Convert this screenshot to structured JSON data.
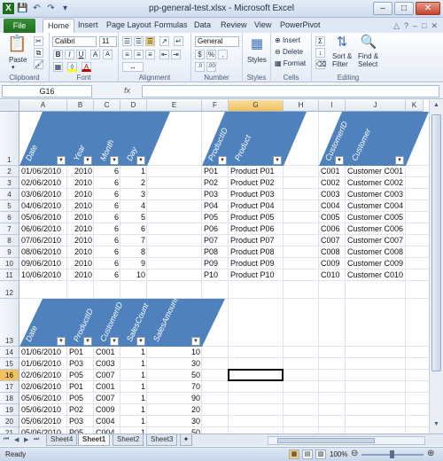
{
  "window": {
    "title": "pp-general-test.xlsx - Microsoft Excel"
  },
  "ribbon_tabs": [
    "File",
    "Home",
    "Insert",
    "Page Layout",
    "Formulas",
    "Data",
    "Review",
    "View",
    "PowerPivot"
  ],
  "ribbon": {
    "clipboard": {
      "label": "Clipboard",
      "paste": "Paste"
    },
    "font": {
      "label": "Font",
      "font_name": "Calibri",
      "font_size": "11"
    },
    "alignment": {
      "label": "Alignment"
    },
    "number": {
      "label": "Number",
      "format": "General"
    },
    "styles": {
      "label": "Styles"
    },
    "cells": {
      "label": "Cells",
      "insert": "Insert",
      "delete": "Delete",
      "format": "Format"
    },
    "editing": {
      "label": "Editing",
      "sort_filter": "Sort &\nFilter",
      "find_select": "Find &\nSelect"
    }
  },
  "formula_bar": {
    "name_box": "G16",
    "fx": "fx",
    "content": ""
  },
  "accent_colors": {
    "table_header": "#4f81bd",
    "selection": "#f1c15f"
  },
  "columns": [
    "A",
    "B",
    "C",
    "D",
    "E",
    "F",
    "G",
    "H",
    "I",
    "J",
    "K"
  ],
  "rows": [
    "1",
    "2",
    "3",
    "4",
    "5",
    "6",
    "7",
    "8",
    "9",
    "10",
    "11",
    "12",
    "13",
    "14",
    "15",
    "16",
    "17",
    "18",
    "19",
    "20",
    "21"
  ],
  "selected_cell": {
    "col": "G",
    "row": "16"
  },
  "date_table": {
    "headers": [
      "Date",
      "Year",
      "Month",
      "Day"
    ],
    "rows": [
      [
        "01/06/2010",
        "2010",
        "6",
        "1"
      ],
      [
        "02/06/2010",
        "2010",
        "6",
        "2"
      ],
      [
        "03/06/2010",
        "2010",
        "6",
        "3"
      ],
      [
        "04/06/2010",
        "2010",
        "6",
        "4"
      ],
      [
        "05/06/2010",
        "2010",
        "6",
        "5"
      ],
      [
        "06/06/2010",
        "2010",
        "6",
        "6"
      ],
      [
        "07/06/2010",
        "2010",
        "6",
        "7"
      ],
      [
        "08/06/2010",
        "2010",
        "6",
        "8"
      ],
      [
        "09/06/2010",
        "2010",
        "6",
        "9"
      ],
      [
        "10/06/2010",
        "2010",
        "6",
        "10"
      ]
    ]
  },
  "product_table": {
    "headers": [
      "ProductID",
      "Product"
    ],
    "rows": [
      [
        "P01",
        "Product P01"
      ],
      [
        "P02",
        "Product P02"
      ],
      [
        "P03",
        "Product P03"
      ],
      [
        "P04",
        "Product P04"
      ],
      [
        "P05",
        "Product P05"
      ],
      [
        "P06",
        "Product P06"
      ],
      [
        "P07",
        "Product P07"
      ],
      [
        "P08",
        "Product P08"
      ],
      [
        "P09",
        "Product P09"
      ],
      [
        "P10",
        "Product P10"
      ]
    ]
  },
  "customer_table": {
    "headers": [
      "CustomerID",
      "Customer"
    ],
    "rows": [
      [
        "C001",
        "Customer C001"
      ],
      [
        "C002",
        "Customer C002"
      ],
      [
        "C003",
        "Customer C003"
      ],
      [
        "C004",
        "Customer C004"
      ],
      [
        "C005",
        "Customer C005"
      ],
      [
        "C006",
        "Customer C006"
      ],
      [
        "C007",
        "Customer C007"
      ],
      [
        "C008",
        "Customer C008"
      ],
      [
        "C009",
        "Customer C009"
      ],
      [
        "C010",
        "Customer C010"
      ]
    ]
  },
  "sales_table": {
    "headers": [
      "Date",
      "ProductID",
      "CustomerID",
      "SalesCount",
      "SalesAmount"
    ],
    "rows": [
      [
        "01/06/2010",
        "P01",
        "C001",
        "1",
        "10"
      ],
      [
        "01/06/2010",
        "P03",
        "C003",
        "1",
        "30"
      ],
      [
        "02/06/2010",
        "P05",
        "C007",
        "1",
        "50"
      ],
      [
        "02/06/2010",
        "P01",
        "C001",
        "1",
        "70"
      ],
      [
        "05/06/2010",
        "P05",
        "C007",
        "1",
        "90"
      ],
      [
        "05/06/2010",
        "P02",
        "C009",
        "1",
        "20"
      ],
      [
        "05/06/2010",
        "P03",
        "C004",
        "1",
        "30"
      ],
      [
        "05/06/2010",
        "P05",
        "C004",
        "1",
        "50"
      ]
    ]
  },
  "sheet_tabs": [
    "Sheet4",
    "Sheet1",
    "Sheet2",
    "Sheet3"
  ],
  "active_sheet": "Sheet1",
  "status": {
    "ready": "Ready",
    "zoom": "100%"
  }
}
